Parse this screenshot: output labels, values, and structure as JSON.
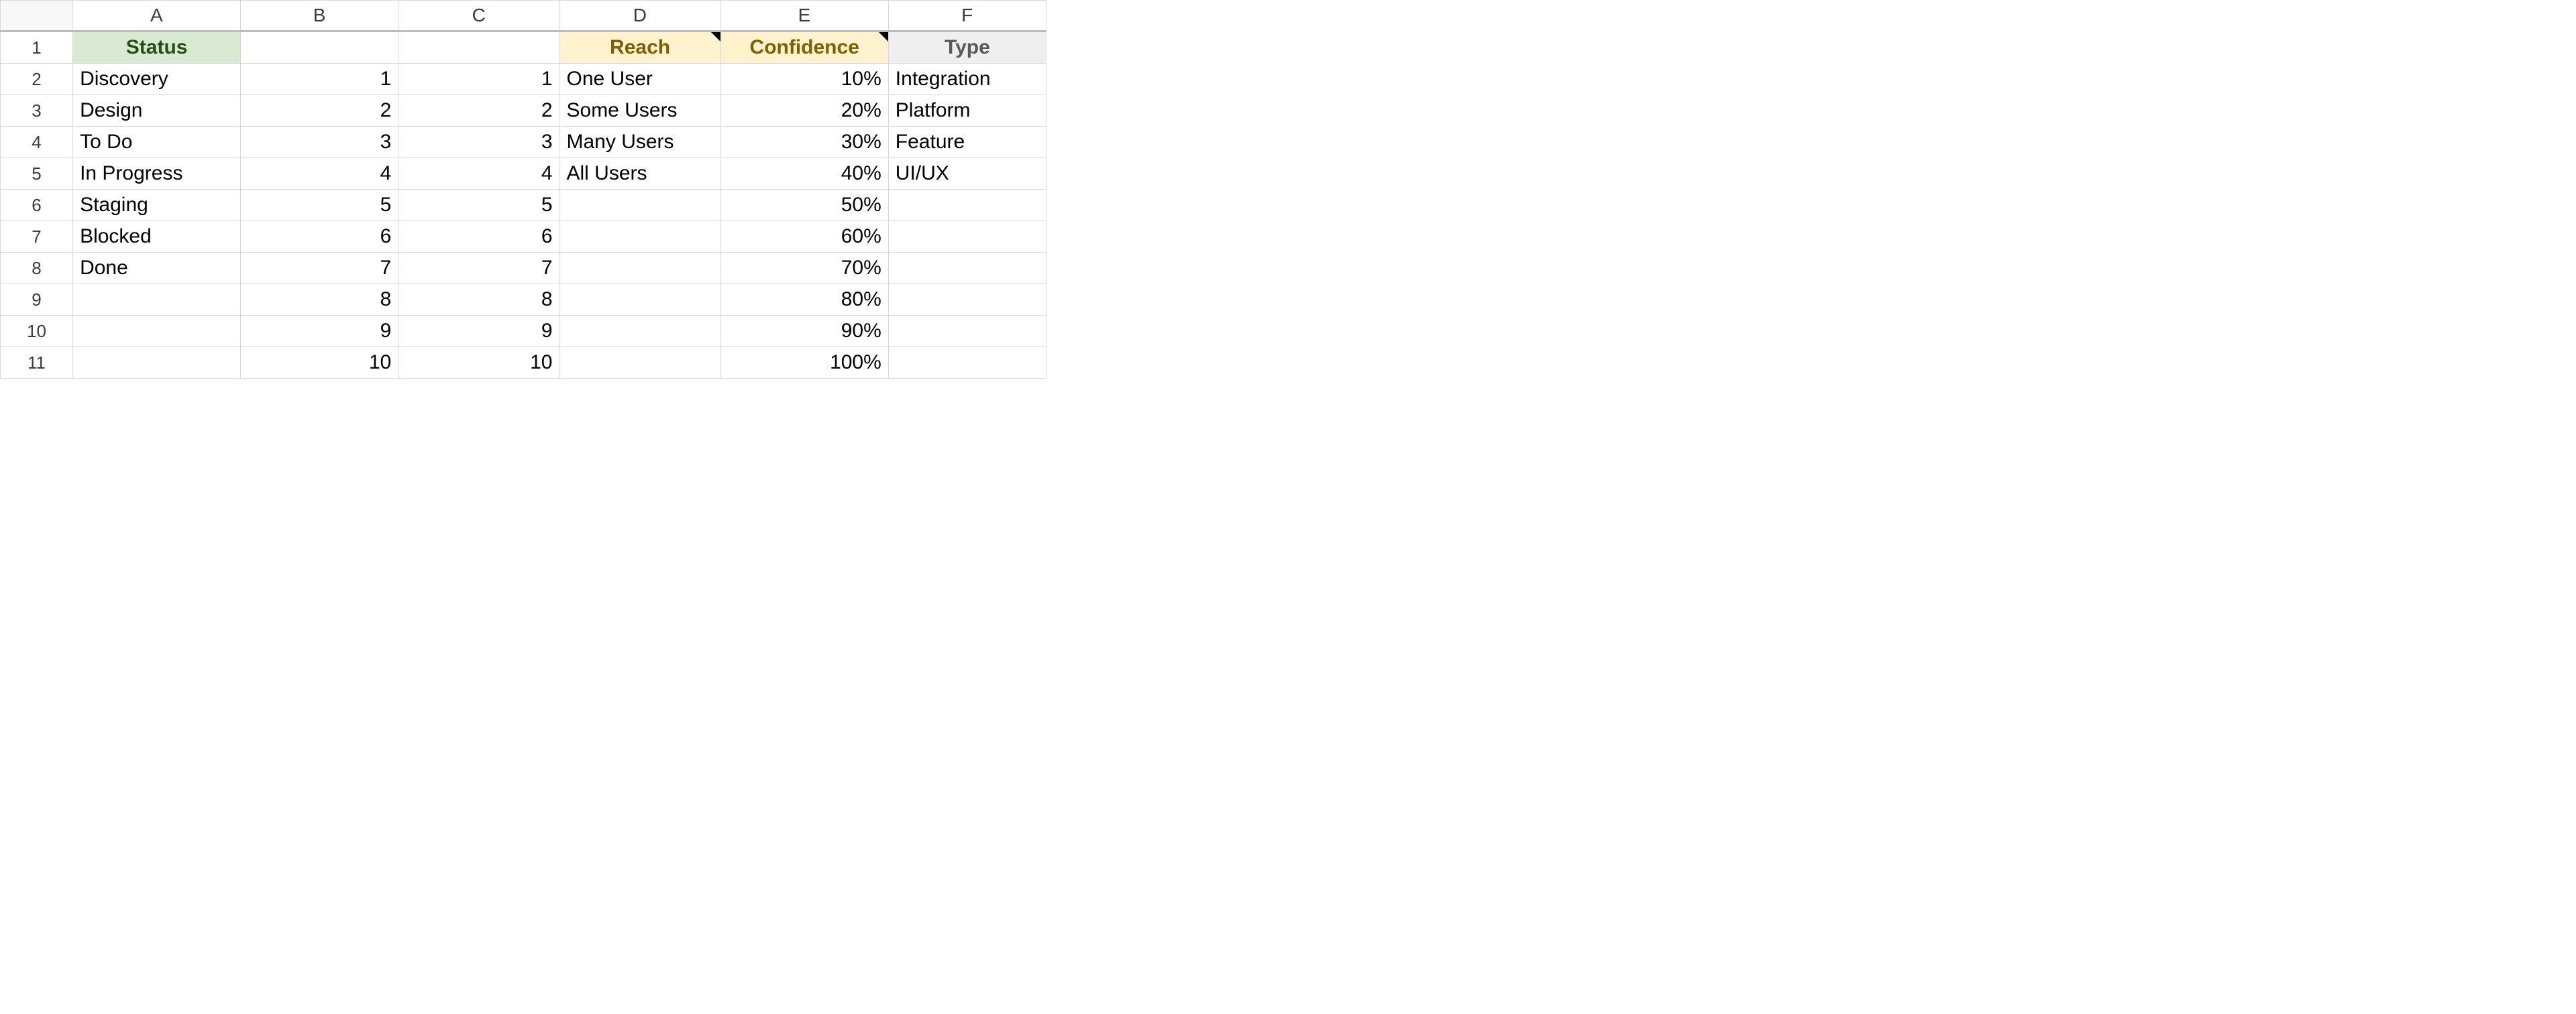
{
  "columns": [
    "A",
    "B",
    "C",
    "D",
    "E",
    "F"
  ],
  "row_numbers": [
    1,
    2,
    3,
    4,
    5,
    6,
    7,
    8,
    9,
    10,
    11
  ],
  "header_row": {
    "A": "Status",
    "B": "",
    "C": "",
    "D": "Reach",
    "E": "Confidence",
    "F": "Type"
  },
  "header_notes": {
    "D": true,
    "E": true
  },
  "rows": [
    {
      "A": "Discovery",
      "B": "1",
      "C": "1",
      "D": "One User",
      "E": "10%",
      "F": "Integration"
    },
    {
      "A": "Design",
      "B": "2",
      "C": "2",
      "D": "Some Users",
      "E": "20%",
      "F": "Platform"
    },
    {
      "A": "To Do",
      "B": "3",
      "C": "3",
      "D": "Many Users",
      "E": "30%",
      "F": "Feature"
    },
    {
      "A": "In Progress",
      "B": "4",
      "C": "4",
      "D": "All Users",
      "E": "40%",
      "F": "UI/UX"
    },
    {
      "A": "Staging",
      "B": "5",
      "C": "5",
      "D": "",
      "E": "50%",
      "F": ""
    },
    {
      "A": "Blocked",
      "B": "6",
      "C": "6",
      "D": "",
      "E": "60%",
      "F": ""
    },
    {
      "A": "Done",
      "B": "7",
      "C": "7",
      "D": "",
      "E": "70%",
      "F": ""
    },
    {
      "A": "",
      "B": "8",
      "C": "8",
      "D": "",
      "E": "80%",
      "F": ""
    },
    {
      "A": "",
      "B": "9",
      "C": "9",
      "D": "",
      "E": "90%",
      "F": ""
    },
    {
      "A": "",
      "B": "10",
      "C": "10",
      "D": "",
      "E": "100%",
      "F": ""
    }
  ],
  "alignment": {
    "A": "txt",
    "B": "num",
    "C": "num",
    "D": "txt",
    "E": "num",
    "F": "txt"
  }
}
